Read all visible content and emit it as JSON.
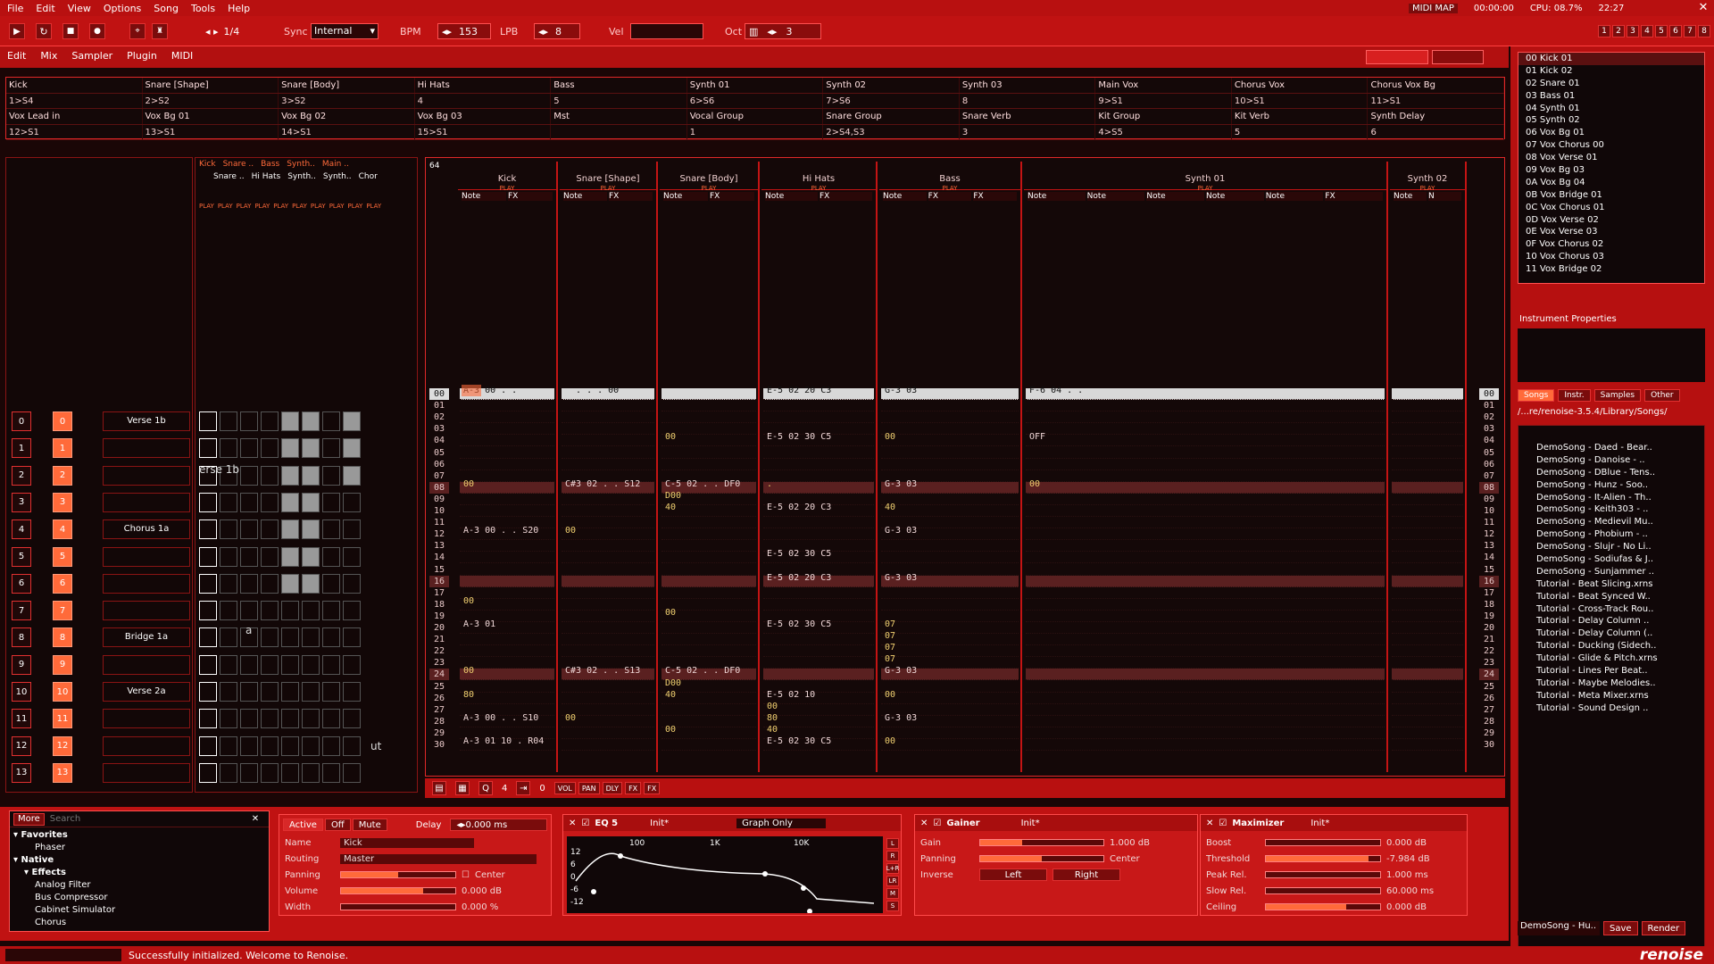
{
  "menu": {
    "items": [
      "File",
      "Edit",
      "View",
      "Options",
      "Song",
      "Tools",
      "Help"
    ]
  },
  "top_right": {
    "midi_map": "MIDI MAP",
    "time": "00:00:00",
    "cpu": "CPU: 08.7%",
    "clock": "22:27"
  },
  "transport": {
    "step": "1/4",
    "sync_label": "Sync",
    "sync_value": "Internal",
    "bpm_label": "BPM",
    "bpm": "153",
    "lpb_label": "LPB",
    "lpb": "8",
    "vel_label": "Vel",
    "oct_label": "Oct",
    "oct": "3",
    "track_buttons": [
      "1",
      "2",
      "3",
      "4",
      "5",
      "6",
      "7",
      "8"
    ]
  },
  "tabs": {
    "items": [
      "Edit",
      "Mix",
      "Sampler",
      "Plugin",
      "MIDI"
    ]
  },
  "track_grid": {
    "rows": [
      [
        "Kick",
        "Snare [Shape]",
        "Snare [Body]",
        "Hi Hats",
        "Bass",
        "Synth 01",
        "Synth 02",
        "Synth 03",
        "Main Vox",
        "Chorus Vox",
        "Chorus Vox Bg"
      ],
      [
        "1>S4",
        "2>S2",
        "3>S2",
        "4",
        "5",
        "6>S6",
        "7>S6",
        "8",
        "9>S1",
        "10>S1",
        "11>S1"
      ],
      [
        "Vox Lead in",
        "Vox Bg 01",
        "Vox Bg 02",
        "Vox Bg 03",
        "Mst",
        "Vocal Group",
        "Snare Group",
        "Snare Verb",
        "Kit Group",
        "Kit Verb",
        "Synth Delay"
      ],
      [
        "12>S1",
        "13>S1",
        "14>S1",
        "15>S1",
        "",
        "1",
        "2>S4,S3",
        "3",
        "4>S5",
        "5",
        "6"
      ]
    ]
  },
  "sequence": {
    "numbers": [
      "0",
      "1",
      "2",
      "3",
      "4",
      "5",
      "6",
      "7",
      "8",
      "9",
      "10",
      "11",
      "12",
      "13"
    ],
    "patterns": [
      "0",
      "1",
      "2",
      "3",
      "4",
      "5",
      "6",
      "7",
      "8",
      "9",
      "10",
      "11",
      "12",
      "13"
    ],
    "sections": [
      {
        "row": 0,
        "name": "Verse 1b"
      },
      {
        "row": 4,
        "name": "Chorus 1a"
      },
      {
        "row": 8,
        "name": "Bridge 1a"
      },
      {
        "row": 10,
        "name": "Verse 2a"
      }
    ]
  },
  "matrix": {
    "headers_top": [
      "Kick",
      "Snare ..",
      "Bass",
      "Synth..",
      "Main .."
    ],
    "headers_bottom": [
      "Snare ..",
      "Hi Hats",
      "Synth..",
      "Synth..",
      "Chor"
    ],
    "play": "PLAY",
    "labels": [
      "erse 1b",
      "a",
      "ut"
    ]
  },
  "pattern": {
    "lines": "64",
    "note_label": "Note",
    "fx_label": "FX",
    "play": "PLAY",
    "off": "OFF",
    "tracks": [
      {
        "name": "Kick",
        "cols": [
          "Note",
          "FX"
        ]
      },
      {
        "name": "Snare [Shape]",
        "cols": [
          "Note",
          "FX"
        ]
      },
      {
        "name": "Snare [Body]",
        "cols": [
          "Note",
          "FX"
        ]
      },
      {
        "name": "Hi Hats",
        "cols": [
          "Note",
          "FX"
        ]
      },
      {
        "name": "Bass",
        "cols": [
          "Note",
          "FX",
          "FX"
        ]
      },
      {
        "name": "Synth 01",
        "cols": [
          "Note",
          "Note",
          "Note",
          "Note",
          "Note",
          "FX"
        ]
      },
      {
        "name": "Synth 02",
        "cols": [
          "Note",
          "N"
        ]
      }
    ],
    "rows": [
      "00",
      "01",
      "02",
      "03",
      "04",
      "05",
      "06",
      "07",
      "08",
      "09",
      "10",
      "11",
      "12",
      "13",
      "14",
      "15",
      "16",
      "17",
      "18",
      "19",
      "20",
      "21",
      "22",
      "23",
      "24",
      "25",
      "26",
      "27",
      "28",
      "29",
      "30"
    ],
    "events": [
      {
        "t": 0,
        "r": 0,
        "v": "A-3 00 . ."
      },
      {
        "t": 1,
        "r": 0,
        "v": "  . . . 00"
      },
      {
        "t": 3,
        "r": 0,
        "v": "E-5 02 20 C3"
      },
      {
        "t": 4,
        "r": 0,
        "v": "G-3 03"
      },
      {
        "t": 5,
        "r": 0,
        "v": "F-6 04 . ."
      },
      {
        "t": 2,
        "r": 4,
        "v": "00"
      },
      {
        "t": 3,
        "r": 4,
        "v": "E-5 02 30 C5"
      },
      {
        "t": 4,
        "r": 4,
        "v": "00"
      },
      {
        "t": 5,
        "r": 4,
        "v": "OFF"
      },
      {
        "t": 0,
        "r": 8,
        "v": "00"
      },
      {
        "t": 1,
        "r": 8,
        "v": "C#3 02 . . S12"
      },
      {
        "t": 2,
        "r": 8,
        "v": "C-5 02 . . DF0"
      },
      {
        "t": 3,
        "r": 8,
        "v": "."
      },
      {
        "t": 4,
        "r": 8,
        "v": "G-3 03"
      },
      {
        "t": 5,
        "r": 8,
        "v": "00"
      },
      {
        "t": 2,
        "r": 9,
        "v": "D00"
      },
      {
        "t": 2,
        "r": 10,
        "v": "40"
      },
      {
        "t": 3,
        "r": 10,
        "v": "E-5 02 20 C3"
      },
      {
        "t": 4,
        "r": 10,
        "v": "40"
      },
      {
        "t": 0,
        "r": 12,
        "v": "A-3 00 . . S20"
      },
      {
        "t": 1,
        "r": 12,
        "v": "00"
      },
      {
        "t": 4,
        "r": 12,
        "v": "G-3 03"
      },
      {
        "t": 3,
        "r": 14,
        "v": "E-5 02 30 C5"
      },
      {
        "t": 3,
        "r": 16,
        "v": "E-5 02 20 C3"
      },
      {
        "t": 4,
        "r": 16,
        "v": "G-3 03"
      },
      {
        "t": 0,
        "r": 18,
        "v": "00"
      },
      {
        "t": 2,
        "r": 19,
        "v": "00"
      },
      {
        "t": 0,
        "r": 20,
        "v": "A-3 01"
      },
      {
        "t": 3,
        "r": 20,
        "v": "E-5 02 30 C5"
      },
      {
        "t": 4,
        "r": 20,
        "v": "07"
      },
      {
        "t": 4,
        "r": 21,
        "v": "07"
      },
      {
        "t": 4,
        "r": 22,
        "v": "07"
      },
      {
        "t": 4,
        "r": 23,
        "v": "07"
      },
      {
        "t": 0,
        "r": 24,
        "v": "00"
      },
      {
        "t": 1,
        "r": 24,
        "v": "C#3 02 . . S13"
      },
      {
        "t": 2,
        "r": 24,
        "v": "C-5 02 . . DF0"
      },
      {
        "t": 4,
        "r": 24,
        "v": "G-3 03"
      },
      {
        "t": 2,
        "r": 25,
        "v": "D00"
      },
      {
        "t": 0,
        "r": 26,
        "v": "80"
      },
      {
        "t": 2,
        "r": 26,
        "v": "40"
      },
      {
        "t": 3,
        "r": 26,
        "v": "E-5 02 10"
      },
      {
        "t": 4,
        "r": 26,
        "v": "00"
      },
      {
        "t": 3,
        "r": 27,
        "v": "00"
      },
      {
        "t": 0,
        "r": 28,
        "v": "A-3 00 . . S10"
      },
      {
        "t": 1,
        "r": 28,
        "v": "00"
      },
      {
        "t": 3,
        "r": 28,
        "v": "80"
      },
      {
        "t": 4,
        "r": 28,
        "v": "G-3 03"
      },
      {
        "t": 2,
        "r": 29,
        "v": "00"
      },
      {
        "t": 3,
        "r": 29,
        "v": "40"
      },
      {
        "t": 0,
        "r": 30,
        "v": "A-3 01 10 . R04"
      },
      {
        "t": 3,
        "r": 30,
        "v": "E-5 02 30 C5"
      },
      {
        "t": 4,
        "r": 30,
        "v": "00"
      }
    ]
  },
  "pattern_toolbar": {
    "q": "4",
    "val": "0",
    "buttons": [
      "VOL",
      "PAN",
      "DLY",
      "FX",
      "FX"
    ]
  },
  "dsp_browser": {
    "more": "More",
    "search_placeholder": "Search",
    "items": [
      {
        "label": "Favorites",
        "level": 0
      },
      {
        "label": "Phaser",
        "level": 2
      },
      {
        "label": "Native",
        "level": 0
      },
      {
        "label": "Effects",
        "level": 1
      },
      {
        "label": "Analog Filter",
        "level": 2
      },
      {
        "label": "Bus Compressor",
        "level": 2
      },
      {
        "label": "Cabinet Simulator",
        "level": 2
      },
      {
        "label": "Chorus",
        "level": 2
      }
    ]
  },
  "track_dsp": {
    "active": "Active",
    "off": "Off",
    "mute": "Mute",
    "delay_label": "Delay",
    "delay_value": "0.000 ms",
    "name_label": "Name",
    "name": "Kick",
    "routing_label": "Routing",
    "routing": "Master",
    "panning_label": "Panning",
    "center": "Center",
    "volume_label": "Volume",
    "volume": "0.000 dB",
    "width_label": "Width",
    "width": "0.000 %",
    "pan_level": 0.5,
    "vol_level": 0.72,
    "width_level": 0.0
  },
  "eq": {
    "title": "EQ 5",
    "preset": "Init*",
    "mode": "Graph Only",
    "freqs": [
      "100",
      "1K",
      "10K"
    ],
    "db": [
      "12",
      "6",
      "0",
      "-6",
      "-12"
    ],
    "side": [
      "L",
      "R",
      "L+R",
      "LR",
      "M",
      "S"
    ]
  },
  "gainer": {
    "title": "Gainer",
    "preset": "Init*",
    "gain_label": "Gain",
    "gain": "1.000 dB",
    "panning_label": "Panning",
    "panning": "Center",
    "inverse_label": "Inverse",
    "left": "Left",
    "right": "Right",
    "gain_level": 0.34,
    "pan_level": 0.5
  },
  "maximizer": {
    "title": "Maximizer",
    "preset": "Init*",
    "params": [
      {
        "label": "Boost",
        "value": "0.000 dB",
        "level": 0.0
      },
      {
        "label": "Threshold",
        "value": "-7.984 dB",
        "level": 0.9
      },
      {
        "label": "Peak Rel.",
        "value": "1.000 ms",
        "level": 0.0
      },
      {
        "label": "Slow Rel.",
        "value": "60.000 ms",
        "level": 0.0
      },
      {
        "label": "Ceiling",
        "value": "0.000 dB",
        "level": 0.7
      }
    ]
  },
  "instruments": {
    "items": [
      "00  Kick 01",
      "01  Kick 02",
      "02  Snare 01",
      "03  Bass 01",
      "04  Synth 01",
      "05  Synth 02",
      "06  Vox Bg 01",
      "07  Vox Chorus 00",
      "08  Vox Verse 01",
      "09  Vox Bg 03",
      "0A  Vox Bg 04",
      "0B  Vox Bridge 01",
      "0C  Vox Chorus 01",
      "0D  Vox Verse 02",
      "0E  Vox Verse 03",
      "0F  Vox Chorus 02",
      "10  Vox Chorus 03",
      "11  Vox Bridge 02"
    ],
    "props_title": "Instrument Properties"
  },
  "browser": {
    "tabs": [
      "Songs",
      "Instr.",
      "Samples",
      "Other"
    ],
    "path": "/...re/renoise-3.5.4/Library/Songs/",
    "files": [
      "DemoSong - Daed - Bear..",
      "DemoSong - Danoise - ..",
      "DemoSong - DBlue - Tens..",
      "DemoSong - Hunz - Soo..",
      "DemoSong - It-Alien - Th..",
      "DemoSong - Keith303 - ..",
      "DemoSong - Medievil Mu..",
      "DemoSong - Phobium - ..",
      "DemoSong - Slujr - No Li..",
      "DemoSong - Sodiufas & J..",
      "DemoSong - Sunjammer ..",
      "Tutorial - Beat Slicing.xrns",
      "Tutorial - Beat Synced W..",
      "Tutorial - Cross-Track Rou..",
      "Tutorial - Delay Column ..",
      "Tutorial - Delay Column (..",
      "Tutorial - Ducking (Sidech..",
      "Tutorial - Glide & Pitch.xrns",
      "Tutorial - Lines Per Beat..",
      "Tutorial - Maybe Melodies..",
      "Tutorial - Meta Mixer.xrns",
      "Tutorial - Sound Design .."
    ],
    "selected": "DemoSong - Hu..",
    "save": "Save",
    "render": "Render"
  },
  "status": {
    "message": "Successfully initialized. Welcome to Renoise.",
    "logo": "renoise"
  },
  "colors": {
    "accent": "#c41414",
    "note": "#f0d8d8",
    "value": "#f0d070",
    "fx": "#5ab0ff",
    "cursor": "#ff6a3a"
  }
}
